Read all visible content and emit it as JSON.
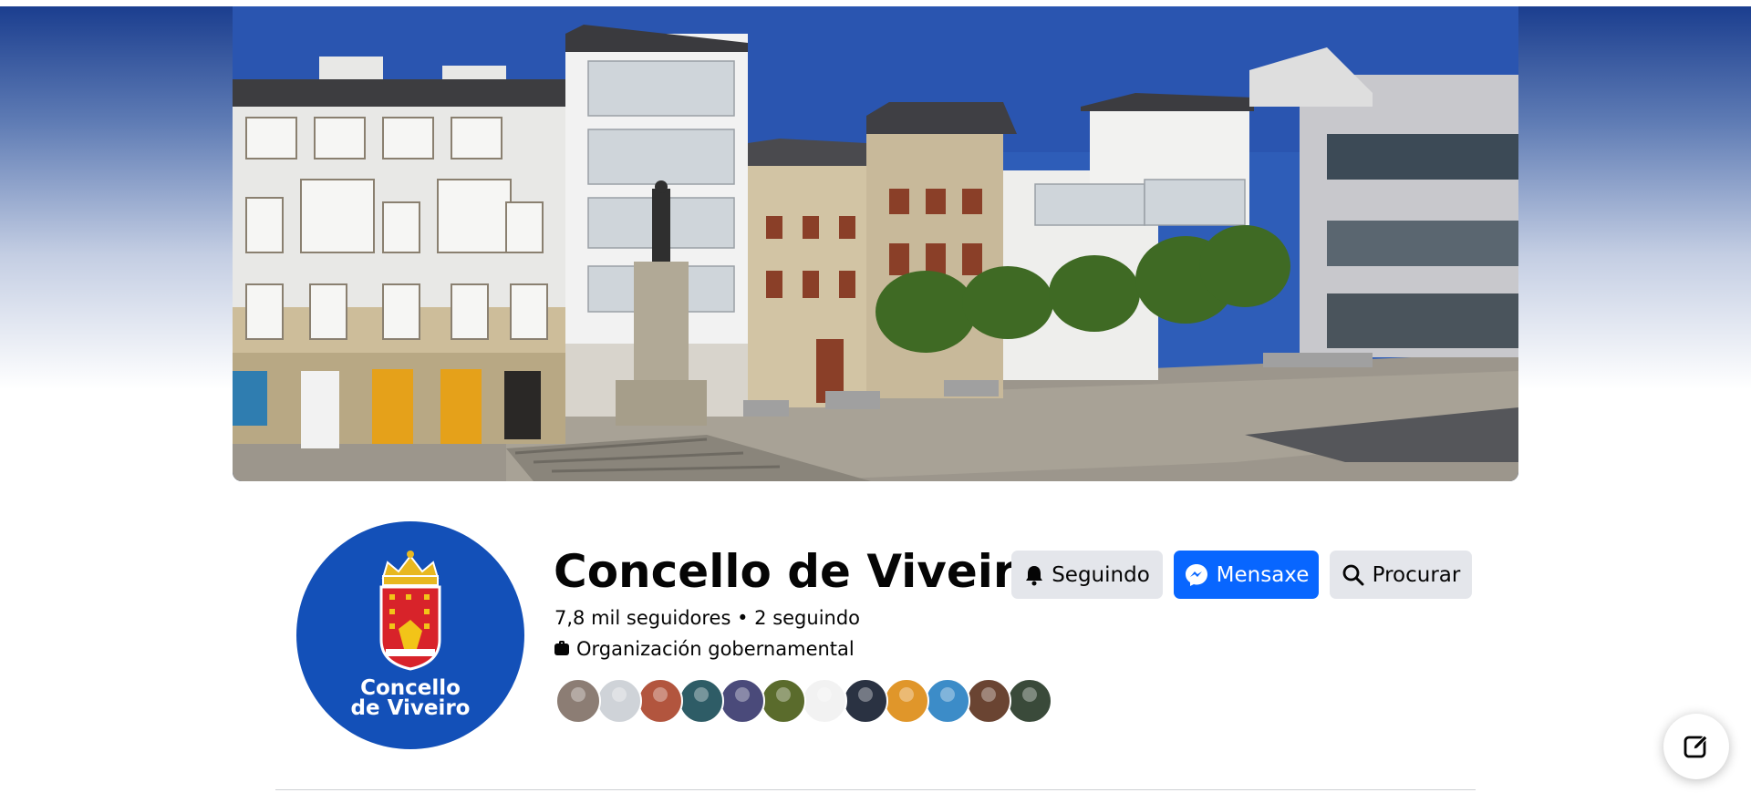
{
  "page": {
    "name": "Concello de Viveiro",
    "followers_text": "7,8 mil seguidores • 2 seguindo",
    "category": "Organización gobernamental"
  },
  "avatar": {
    "line1": "Concello",
    "line2": "de Viveiro",
    "bg_color": "#1350b8"
  },
  "buttons": {
    "following": "Seguindo",
    "message": "Mensaxe",
    "search": "Procurar"
  },
  "mutual_followers": [
    {
      "name": "face-1",
      "color": "#8c7d74"
    },
    {
      "name": "face-2",
      "color": "#cfd3d8"
    },
    {
      "name": "face-3",
      "color": "#b2553e"
    },
    {
      "name": "face-4",
      "color": "#2e5c66"
    },
    {
      "name": "face-5",
      "color": "#4a4a7a"
    },
    {
      "name": "face-6",
      "color": "#5a6b2c"
    },
    {
      "name": "face-7",
      "color": "#f2f2f2"
    },
    {
      "name": "face-8",
      "color": "#2a3242"
    },
    {
      "name": "face-9",
      "color": "#e0962a"
    },
    {
      "name": "face-10",
      "color": "#3c8cc8"
    },
    {
      "name": "face-11",
      "color": "#6a4432"
    },
    {
      "name": "face-12",
      "color": "#3a4a3a"
    }
  ],
  "colors": {
    "accent_blue": "#0866ff",
    "button_gray": "#e4e6eb"
  },
  "icons": {
    "following": "bell-icon",
    "message": "messenger-icon",
    "search": "search-icon",
    "compose": "compose-icon",
    "category": "briefcase-icon"
  }
}
